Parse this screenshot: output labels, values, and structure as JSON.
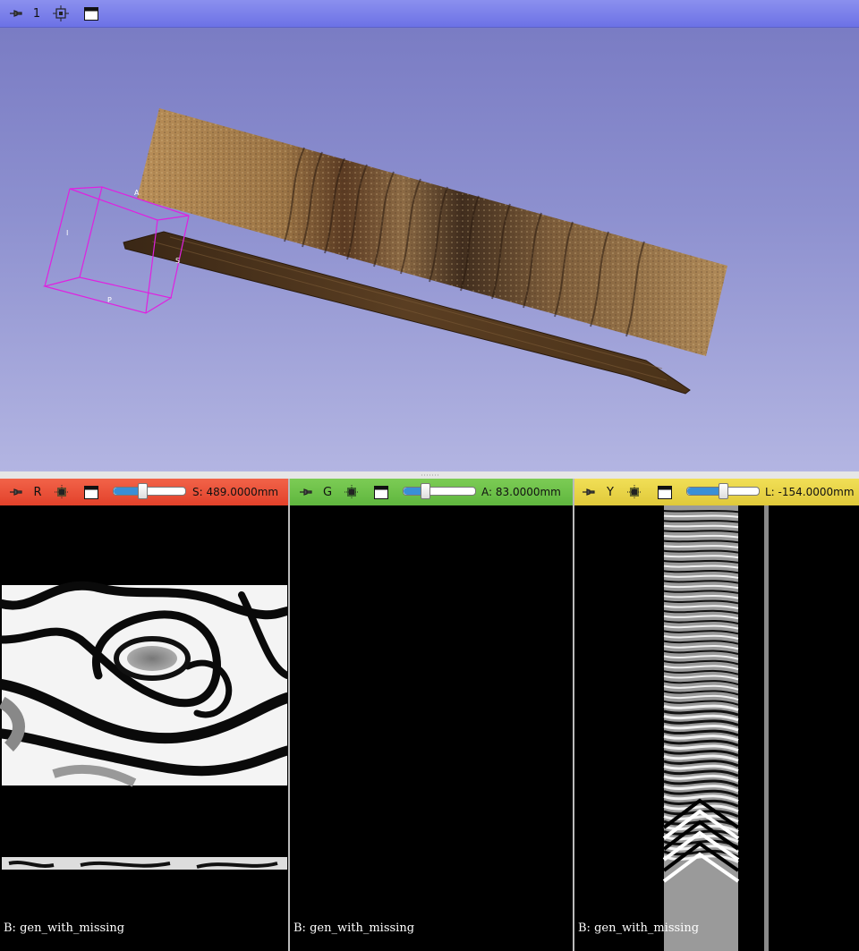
{
  "view3d": {
    "layout_number": "1",
    "pin_icon": "pin-icon",
    "center_icon": "center-view-icon",
    "maximize_icon": "maximize-view-icon",
    "roi_labels": {
      "A": "A",
      "I": "I",
      "P": "P",
      "S": "S"
    },
    "roi_color": "#e020e0",
    "background_top": "#7779c2",
    "background_bottom": "#b3b5e2"
  },
  "slices": [
    {
      "id": "red",
      "orientation_letter": "R",
      "offset_text": "S: 489.0000mm",
      "slider_fraction": 0.4,
      "background_layer": "B: gen_with_missing",
      "color": "#e2412a"
    },
    {
      "id": "green",
      "orientation_letter": "G",
      "offset_text": "A: 83.0000mm",
      "slider_fraction": 0.3,
      "background_layer": "B: gen_with_missing",
      "color": "#5fb63e"
    },
    {
      "id": "yellow",
      "orientation_letter": "Y",
      "offset_text": "L: -154.0000mm",
      "slider_fraction": 0.5,
      "background_layer": "B: gen_with_missing",
      "color": "#e0c93a"
    }
  ]
}
